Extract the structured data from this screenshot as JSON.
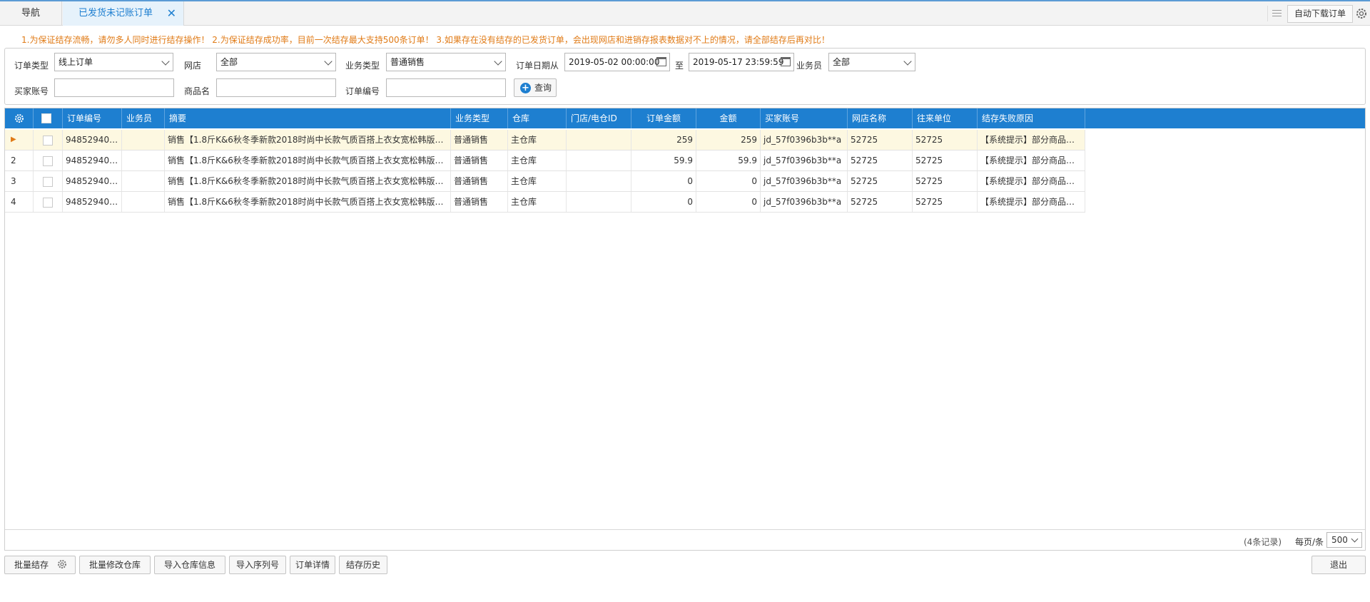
{
  "tabs": {
    "nav": "导航",
    "active": "已发货未记账订单"
  },
  "toolbar": {
    "auto_download": "自动下载订单"
  },
  "notice": "1.为保证结存流畅，请勿多人同时进行结存操作！  2.为保证结存成功率，目前一次结存最大支持500条订单！  3.如果存在没有结存的已发货订单，会出现网店和进销存报表数据对不上的情况，请全部结存后再对比！",
  "filters": {
    "order_type_label": "订单类型",
    "order_type": "线上订单",
    "shop_label": "网店",
    "shop": "全部",
    "biz_type_label": "业务类型",
    "biz_type": "普通销售",
    "date_from_label": "订单日期从",
    "date_from": "2019-05-02 00:00:00",
    "to_label": "至",
    "date_to": "2019-05-17 23:59:59",
    "salesman_label": "业务员",
    "salesman": "全部",
    "buyer_label": "买家账号",
    "buyer": "",
    "product_label": "商品名",
    "product": "",
    "order_no_label": "订单编号",
    "order_no": "",
    "query": "查询"
  },
  "grid": {
    "headers": [
      "订单编号",
      "业务员",
      "摘要",
      "业务类型",
      "仓库",
      "门店/电仓ID",
      "订单金额",
      "金额",
      "买家账号",
      "网店名称",
      "往来单位",
      "结存失败原因"
    ],
    "rows": [
      {
        "idx": "▶",
        "order": "948529405...",
        "salesman": "",
        "summary": "销售【1.8斤K&6秋冬季新款2018时尚中长款气质百搭上衣女宽松韩版棉...",
        "biz": "普通销售",
        "wh": "主仓库",
        "store": "",
        "amt": "259",
        "money": "259",
        "buyer": "jd_57f0396b3b**a",
        "shop": "52725",
        "partner": "52725",
        "reason": "【系统提示】部分商品没..."
      },
      {
        "idx": "2",
        "order": "948529405...",
        "salesman": "",
        "summary": "销售【1.8斤K&6秋冬季新款2018时尚中长款气质百搭上衣女宽松韩版棉...",
        "biz": "普通销售",
        "wh": "主仓库",
        "store": "",
        "amt": "59.9",
        "money": "59.9",
        "buyer": "jd_57f0396b3b**a",
        "shop": "52725",
        "partner": "52725",
        "reason": "【系统提示】部分商品没..."
      },
      {
        "idx": "3",
        "order": "948529405...",
        "salesman": "",
        "summary": "销售【1.8斤K&6秋冬季新款2018时尚中长款气质百搭上衣女宽松韩版棉...",
        "biz": "普通销售",
        "wh": "主仓库",
        "store": "",
        "amt": "0",
        "money": "0",
        "buyer": "jd_57f0396b3b**a",
        "shop": "52725",
        "partner": "52725",
        "reason": "【系统提示】部分商品没..."
      },
      {
        "idx": "4",
        "order": "948529405...",
        "salesman": "",
        "summary": "销售【1.8斤K&6秋冬季新款2018时尚中长款气质百搭上衣女宽松韩版棉...",
        "biz": "普通销售",
        "wh": "主仓库",
        "store": "",
        "amt": "0",
        "money": "0",
        "buyer": "jd_57f0396b3b**a",
        "shop": "52725",
        "partner": "52725",
        "reason": "【系统提示】部分商品没..."
      }
    ],
    "record_count": "(4条记录)",
    "per_page_label": "每页/条",
    "per_page": "500"
  },
  "actions": {
    "batch_settle": "批量结存",
    "batch_wh": "批量修改仓库",
    "import_wh": "导入仓库信息",
    "import_serial": "导入序列号",
    "order_detail": "订单详情",
    "settle_history": "结存历史",
    "exit": "退出"
  },
  "colors": {
    "accent": "#1e7fd0",
    "notice": "#e07b17",
    "selected_row": "#fdf8e1"
  }
}
